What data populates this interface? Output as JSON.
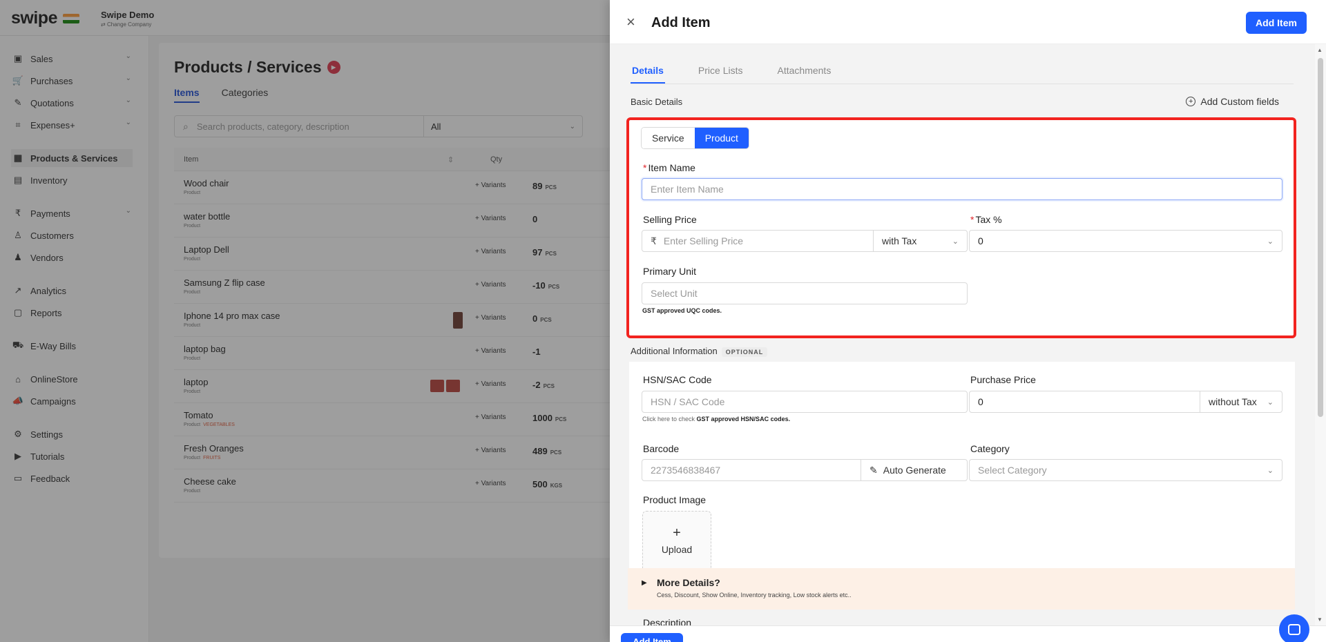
{
  "brand": {
    "logo": "swipe",
    "company_name": "Swipe Demo",
    "company_sub": "Change Company"
  },
  "sidebar": {
    "items": [
      {
        "label": "Sales",
        "icon": "sales-icon",
        "glyph": "▣",
        "chevron": true
      },
      {
        "label": "Purchases",
        "icon": "cart-icon",
        "glyph": "🛒",
        "chevron": true
      },
      {
        "label": "Quotations",
        "icon": "pen-icon",
        "glyph": "✎",
        "chevron": true
      },
      {
        "label": "Expenses+",
        "icon": "tag-icon",
        "glyph": "⌗",
        "chevron": true
      },
      {
        "label": "Products & Services",
        "icon": "barcode-icon",
        "glyph": "▦",
        "chevron": false,
        "active": true
      },
      {
        "label": "Inventory",
        "icon": "inventory-icon",
        "glyph": "▤",
        "chevron": false
      },
      {
        "label": "Payments",
        "icon": "rupee-icon",
        "glyph": "₹",
        "chevron": true
      },
      {
        "label": "Customers",
        "icon": "user-icon",
        "glyph": "♙",
        "chevron": false
      },
      {
        "label": "Vendors",
        "icon": "users-icon",
        "glyph": "♟",
        "chevron": false
      },
      {
        "label": "Analytics",
        "icon": "chart-icon",
        "glyph": "↗",
        "chevron": false
      },
      {
        "label": "Reports",
        "icon": "report-icon",
        "glyph": "▢",
        "chevron": false
      },
      {
        "label": "E-Way Bills",
        "icon": "truck-icon",
        "glyph": "⛟",
        "chevron": false
      },
      {
        "label": "OnlineStore",
        "icon": "store-icon",
        "glyph": "⌂",
        "chevron": false
      },
      {
        "label": "Campaigns",
        "icon": "megaphone-icon",
        "glyph": "📣",
        "chevron": false
      },
      {
        "label": "Settings",
        "icon": "gear-icon",
        "glyph": "⚙",
        "chevron": false
      },
      {
        "label": "Tutorials",
        "icon": "video-icon",
        "glyph": "▶",
        "chevron": false
      },
      {
        "label": "Feedback",
        "icon": "message-icon",
        "glyph": "▭",
        "chevron": false
      }
    ]
  },
  "main": {
    "title": "Products / Services",
    "tabs": [
      "Items",
      "Categories"
    ],
    "search_placeholder": "Search products, category, description",
    "filter_value": "All",
    "columns": {
      "item": "Item",
      "qty": "Qty"
    },
    "variants_label": "+ Variants",
    "rows": [
      {
        "name": "Wood chair",
        "type": "Product",
        "qty": "89",
        "unit": "PCS"
      },
      {
        "name": "water bottle",
        "type": "Product",
        "qty": "0",
        "unit": ""
      },
      {
        "name": "Laptop Dell",
        "type": "Product",
        "qty": "97",
        "unit": "PCS"
      },
      {
        "name": "Samsung Z flip case",
        "type": "Product",
        "qty": "-10",
        "unit": "PCS"
      },
      {
        "name": "Iphone 14 pro max case",
        "type": "Product",
        "qty": "0",
        "unit": "PCS"
      },
      {
        "name": "laptop bag",
        "type": "Product",
        "qty": "-1",
        "unit": ""
      },
      {
        "name": "laptop",
        "type": "Product",
        "qty": "-2",
        "unit": "PCS"
      },
      {
        "name": "Tomato",
        "type": "Product",
        "category": "VEGETABLES",
        "qty": "1000",
        "unit": "PCS"
      },
      {
        "name": "Fresh Oranges",
        "type": "Product",
        "category": "FRUITS",
        "qty": "489",
        "unit": "PCS"
      },
      {
        "name": "Cheese cake",
        "type": "Product",
        "qty": "500",
        "unit": "KGS"
      }
    ]
  },
  "drawer": {
    "title": "Add Item",
    "add_button": "Add Item",
    "tabs": [
      "Details",
      "Price Lists",
      "Attachments"
    ],
    "basic_details": "Basic Details",
    "add_custom_fields": "Add Custom fields",
    "type_options": [
      "Service",
      "Product"
    ],
    "selected_type": "Product",
    "item_name": {
      "label": "Item Name",
      "placeholder": "Enter Item Name"
    },
    "selling_price": {
      "label": "Selling Price",
      "currency": "₹",
      "placeholder": "Enter Selling Price",
      "tax_mode": "with Tax"
    },
    "tax": {
      "label": "Tax %",
      "value": "0"
    },
    "primary_unit": {
      "label": "Primary Unit",
      "placeholder": "Select Unit",
      "hint": "GST approved UQC codes."
    },
    "additional_info": "Additional Information",
    "optional_badge": "OPTIONAL",
    "hsn": {
      "label": "HSN/SAC Code",
      "placeholder": "HSN / SAC Code",
      "hint_prefix": "Click here to check",
      "hint_bold": "GST approved HSN/SAC codes."
    },
    "purchase_price": {
      "label": "Purchase Price",
      "value": "0",
      "tax_mode": "without Tax"
    },
    "barcode": {
      "label": "Barcode",
      "placeholder": "2273546838467",
      "auto_generate": "Auto Generate"
    },
    "category": {
      "label": "Category",
      "placeholder": "Select Category"
    },
    "product_image": {
      "label": "Product Image",
      "upload": "Upload"
    },
    "more_details": {
      "title": "More Details?",
      "subtitle": "Cess, Discount, Show Online, Inventory tracking, Low stock alerts etc.."
    },
    "description_label": "Description"
  },
  "colors": {
    "primary": "#1f5fff",
    "highlight": "#f2231f",
    "required": "#e0242a",
    "more_bg": "#fdf0e6"
  }
}
